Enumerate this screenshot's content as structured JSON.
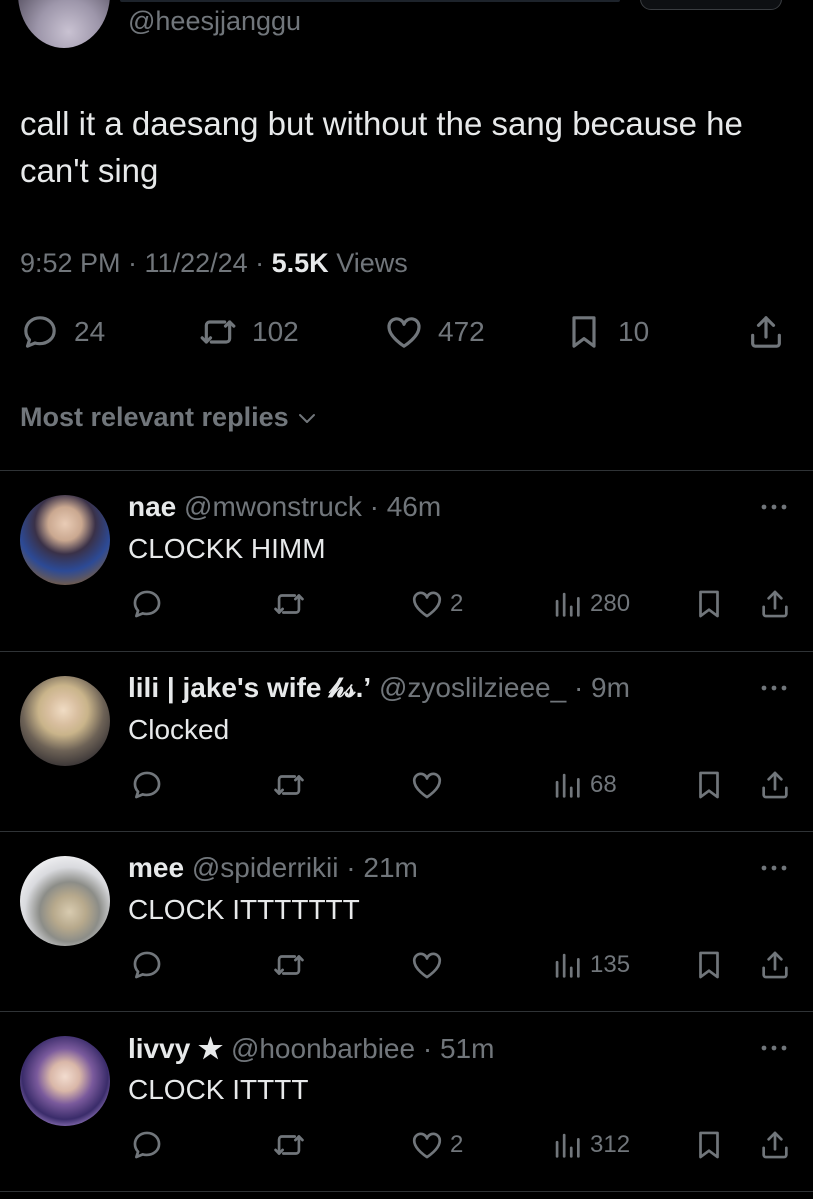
{
  "tweet": {
    "handle": "@heesjjanggu",
    "text": "call it a daesang but without the sang because he can't sing",
    "time": "9:52 PM · 11/22/24 · ",
    "views_count": "5.5K",
    "views_label": " Views",
    "stats": {
      "replies": "24",
      "retweets": "102",
      "likes": "472",
      "bookmarks": "10"
    }
  },
  "sort_label": "Most relevant replies",
  "replies": [
    {
      "name": "nae",
      "handle": "@mwonstruck",
      "time": "· 46m",
      "text": "CLOCKK HIMM",
      "likes": "2",
      "views": "280"
    },
    {
      "name": "lili | jake's wife 𝒽𝓈.’",
      "handle": "@zyoslilzieee_",
      "time": "· 9m",
      "text": "Clocked",
      "likes": "",
      "views": "68"
    },
    {
      "name": "mee",
      "handle": "@spiderrikii",
      "time": "· 21m",
      "text": "CLOCK ITTTTTTT",
      "likes": "",
      "views": "135"
    },
    {
      "name": "livvy ★",
      "handle": "@hoonbarbiee",
      "time": "· 51m",
      "text": "CLOCK ITTTT",
      "likes": "2",
      "views": "312"
    }
  ],
  "colors": {
    "background": "#000000",
    "text_primary": "#e7e9ea",
    "text_secondary": "#71767b",
    "divider": "#2f3336"
  }
}
